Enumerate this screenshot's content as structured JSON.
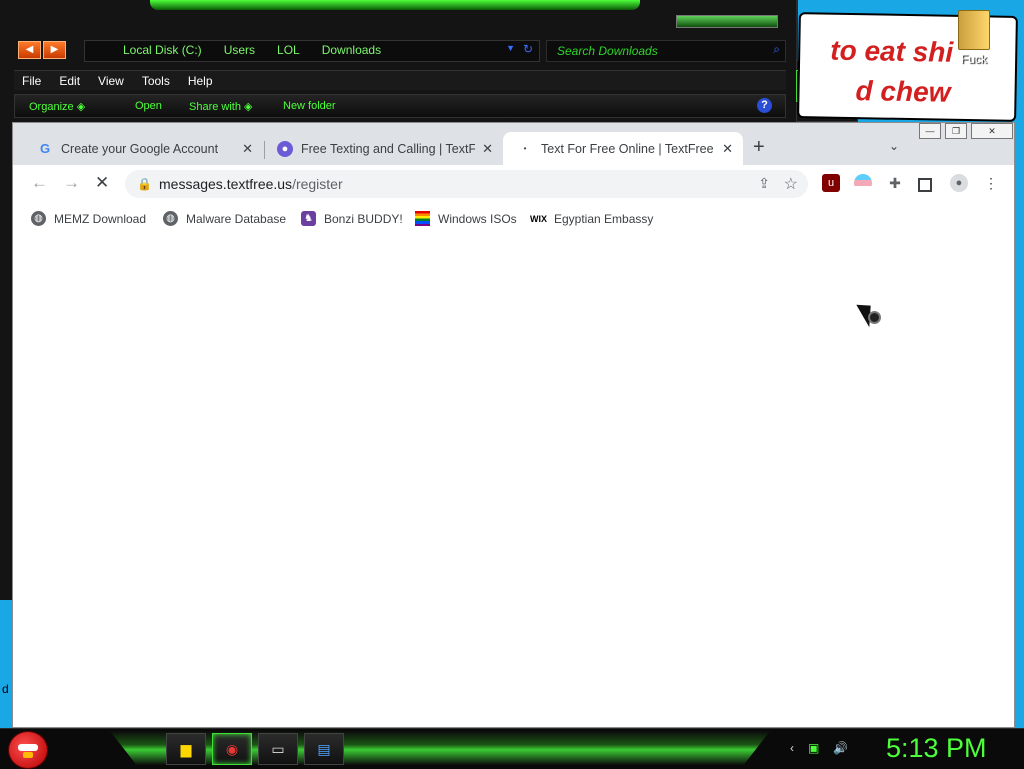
{
  "explorer": {
    "nav_back": "◀",
    "nav_forward": "▶",
    "breadcrumbs": [
      "Local Disk (C:)",
      "Users",
      "LOL",
      "Downloads"
    ],
    "search_placeholder": "Search Downloads",
    "menu": [
      "File",
      "Edit",
      "View",
      "Tools",
      "Help"
    ],
    "commands": [
      "Organize ◈",
      "Open",
      "Share with ◈",
      "New folder"
    ],
    "help_glyph": "?"
  },
  "banner": {
    "line1": "to eat shi",
    "line2": "d chew"
  },
  "desktop": {
    "folder_label": "Fuck",
    "left_text": "d"
  },
  "browser": {
    "tabs": [
      {
        "title": "Create your Google Account",
        "icon": "google-icon"
      },
      {
        "title": "Free Texting and Calling | TextFre",
        "icon": "chat-icon"
      },
      {
        "title": "Text For Free Online | TextFree W",
        "icon": "loading-dot-icon"
      }
    ],
    "new_tab": "+",
    "url_host": "messages.textfree.us",
    "url_path": "/register",
    "bookmarks": [
      {
        "label": "MEMZ Download",
        "icon": "globe-icon"
      },
      {
        "label": "Malware Database",
        "icon": "globe-icon"
      },
      {
        "label": "Bonzi BUDDY!",
        "icon": "bonzi-icon"
      },
      {
        "label": "Windows ISOs",
        "icon": "rainbow-flag-icon"
      },
      {
        "label": "Egyptian Embassy",
        "icon": "wix-icon"
      }
    ],
    "wix_text": "WIX"
  },
  "taskbar": {
    "clock": "5:13 PM"
  }
}
